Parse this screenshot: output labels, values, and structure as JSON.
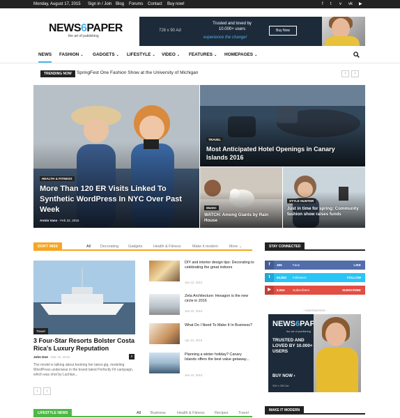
{
  "topbar": {
    "date": "Monday, August 17, 2015",
    "links": [
      "Sign in / Join",
      "Blog",
      "Forums",
      "Contact",
      "Buy now!"
    ],
    "social_icons": [
      "facebook-icon",
      "twitter-icon",
      "vimeo-icon",
      "vk-icon",
      "youtube-icon"
    ]
  },
  "logo": {
    "name_part1": "NEWS",
    "name_six": "6",
    "name_part2": "PAPER",
    "tagline": "the art of publishing"
  },
  "top_ad": {
    "size": "728 x 90 Ad",
    "line1": "Trusted and loved by",
    "line2": "10.000+ users",
    "button": "Buy Now",
    "tagline": "experience the change!"
  },
  "nav": {
    "items": [
      {
        "label": "NEWS",
        "active": true,
        "dropdown": false
      },
      {
        "label": "FASHION",
        "dropdown": true
      },
      {
        "label": "GADGETS",
        "dropdown": true
      },
      {
        "label": "LIFESTYLE",
        "dropdown": true
      },
      {
        "label": "VIDEO",
        "dropdown": true
      },
      {
        "label": "FEATURES",
        "dropdown": true
      },
      {
        "label": "HOMEPAGES",
        "dropdown": true
      }
    ],
    "caret": "⌄",
    "search_icon": "search-icon"
  },
  "trending": {
    "badge": "TRENDING NOW",
    "headline": "SpringFest One Fashion Show at the University of Michigan",
    "prev": "‹",
    "next": "›"
  },
  "featured": {
    "big": {
      "category": "HEALTH & FITNESS",
      "title": "More Than 120 ER Visits Linked To Synthetic WordPress In NYC Over Past Week",
      "author": "Armin Vans",
      "date": "Feb 22, 2015"
    },
    "right_top": {
      "category": "TRAVEL",
      "title": "Most Anticipated Hotel Openings in Canary Islands 2016"
    },
    "bottom_left": {
      "category": "MUSIC",
      "title": "WATCH: Among Giants by Rain House"
    },
    "bottom_right": {
      "category": "STYLE HUNTER",
      "title": "Just in time for spring: Community fashion show raises funds"
    }
  },
  "dont_miss": {
    "label": "DON'T MISS",
    "accent": "#f5a623",
    "tabs": [
      "All",
      "Decorating",
      "Gadgets",
      "Health & Fitness",
      "Make it modern",
      "More"
    ],
    "main": {
      "category": "Travel",
      "title": "3 Four-Star Resorts Bolster Costa Rica's Luxury Reputation",
      "author": "John Doe",
      "date": "Mar 22, 2015",
      "comments": "0",
      "excerpt": "The model is talking about booking her latest gig, modeling WordPress underwear in the brand latest Perfectly Fit campaign, which was shot by Lachlan..."
    },
    "side": [
      {
        "title": "DIY and interior design tips: Decorating to celebrating the great indoors",
        "date": "Jan 22, 2015"
      },
      {
        "title": "Zeta Architecture: Hexagon is the new circle in 2016",
        "date": "Jan 22, 2015"
      },
      {
        "title": "What Do I Need To Make It In Business?",
        "date": "Apr 23, 2015"
      },
      {
        "title": "Planning a winter holiday? Canary Islands offers the best value getaway...",
        "date": "Jan 22, 2015"
      }
    ],
    "prev": "‹",
    "next": "›"
  },
  "stay_connected": {
    "label": "STAY CONNECTED",
    "rows": [
      {
        "icon": "f",
        "count": "495",
        "name": "Fans",
        "action": "LIKE",
        "color": "#516eab"
      },
      {
        "icon": "t",
        "count": "54,862",
        "name": "Followers",
        "action": "FOLLOW",
        "color": "#29c5f6"
      },
      {
        "icon": "▶",
        "count": "8,554",
        "name": "Subscribers",
        "action": "SUBSCRIBE",
        "color": "#e14e42"
      }
    ]
  },
  "side_ad": {
    "label": "- Advertisement -",
    "logo_part1": "NEWS",
    "logo_six": "6",
    "logo_part2": "PAPER",
    "logo_tagline": "the art of publishing",
    "text": "TRUSTED AND LOVED BY 10.000+ USERS",
    "button": "BUY NOW ›",
    "size": "300 x 250 Ad"
  },
  "lifestyle_news": {
    "label": "LIFESTYLE NEWS",
    "accent": "#4db848",
    "tabs": [
      "All",
      "Business",
      "Health & Fitness",
      "Recipes",
      "Travel"
    ]
  },
  "make_it_modern": {
    "label": "MAKE IT MODERN"
  },
  "colors": {
    "accent": "#4db2ec",
    "dark": "#222222"
  }
}
